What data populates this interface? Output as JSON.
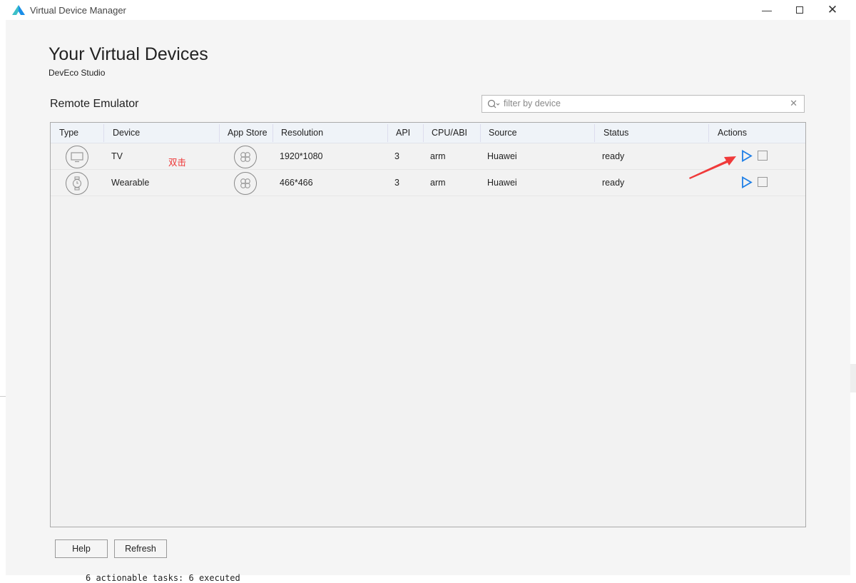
{
  "window": {
    "title": "Virtual Device Manager",
    "controls": [
      "minimize",
      "maximize",
      "close"
    ]
  },
  "header": {
    "title": "Your Virtual Devices",
    "subtitle": "DevEco Studio"
  },
  "section_title": "Remote Emulator",
  "search": {
    "placeholder": "filter by device",
    "value": ""
  },
  "table": {
    "columns": [
      "Type",
      "Device",
      "App Store",
      "Resolution",
      "API",
      "CPU/ABI",
      "Source",
      "Status",
      "Actions"
    ],
    "rows": [
      {
        "type_icon": "tv-icon",
        "device": "TV",
        "resolution": "1920*1080",
        "api": "3",
        "cpu": "arm",
        "source": "Huawei",
        "status": "ready"
      },
      {
        "type_icon": "watch-icon",
        "device": "Wearable",
        "resolution": "466*466",
        "api": "3",
        "cpu": "arm",
        "source": "Huawei",
        "status": "ready"
      }
    ]
  },
  "annotation": {
    "text": "双击",
    "color": "#ee3333"
  },
  "buttons": {
    "help": "Help",
    "refresh": "Refresh"
  },
  "background_console": "6 actionable tasks: 6 executed",
  "colors": {
    "accent": "#1e7fe6",
    "annotation": "#ee3333"
  }
}
